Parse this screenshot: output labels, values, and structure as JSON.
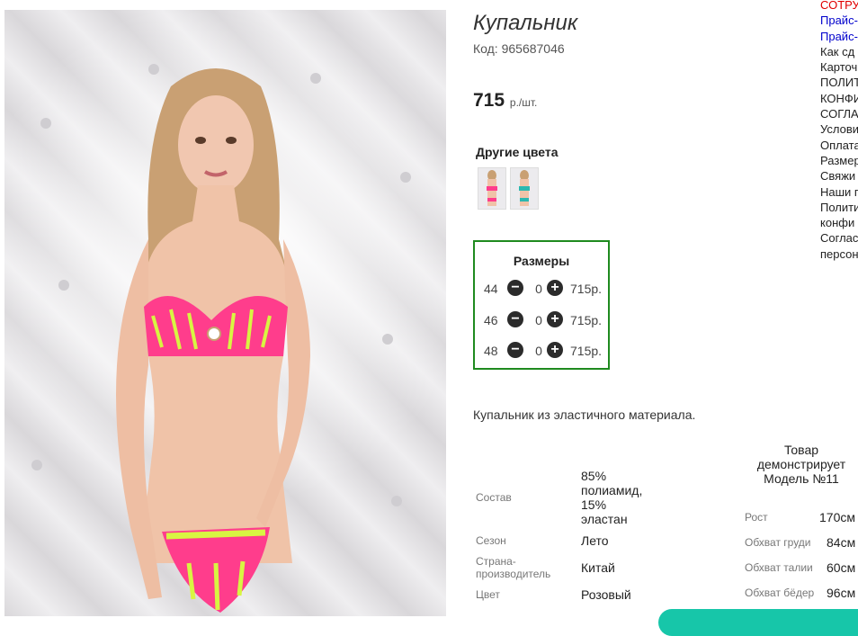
{
  "product": {
    "title": "Купальник",
    "code": "Код: 965687046",
    "price": "715",
    "price_unit": "р./шт.",
    "description": "Купальник из эластичного материала."
  },
  "colors": {
    "heading": "Другие цвета",
    "swatches": [
      "pink-swimsuit-thumbnail",
      "turquoise-swimsuit-thumbnail"
    ]
  },
  "sizes": {
    "heading": "Размеры",
    "rows": [
      {
        "size": "44",
        "qty": "0",
        "price": "715р."
      },
      {
        "size": "46",
        "qty": "0",
        "price": "715р."
      },
      {
        "size": "48",
        "qty": "0",
        "price": "715р."
      }
    ]
  },
  "specs": [
    {
      "label": "Состав",
      "value": "85% полиамид, 15% эластан"
    },
    {
      "label": "Сезон",
      "value": "Лето"
    },
    {
      "label": "Страна-производитель",
      "value": "Китай"
    },
    {
      "label": "Цвет",
      "value": "Розовый"
    }
  ],
  "model": {
    "heading": "Товар демонстрирует Модель №11",
    "params": [
      {
        "label": "Рост",
        "value": "170см"
      },
      {
        "label": "Обхват груди",
        "value": "84см"
      },
      {
        "label": "Обхват талии",
        "value": "60см"
      },
      {
        "label": "Обхват бёдер",
        "value": "96см"
      }
    ]
  },
  "right_menu": [
    "СОТРУ",
    "Прайс-",
    "Прайс-",
    "Как сд",
    "Карточ",
    "ПОЛИТ",
    "КОНФИ",
    "СОГЛА",
    "Услови",
    "Оплата",
    "Размер",
    "Свяжи",
    "Наши п",
    "Полити",
    "конфи",
    "Соглас",
    "персон"
  ],
  "colors_palette": {
    "sizes_border": "#1f8a1f",
    "menu_red": "#e00000",
    "menu_blue": "#0000cc",
    "swimsuit_pink": "#ff3d8c",
    "swimsuit_lime": "#d8f542",
    "chat_accent": "#17c6a9"
  }
}
